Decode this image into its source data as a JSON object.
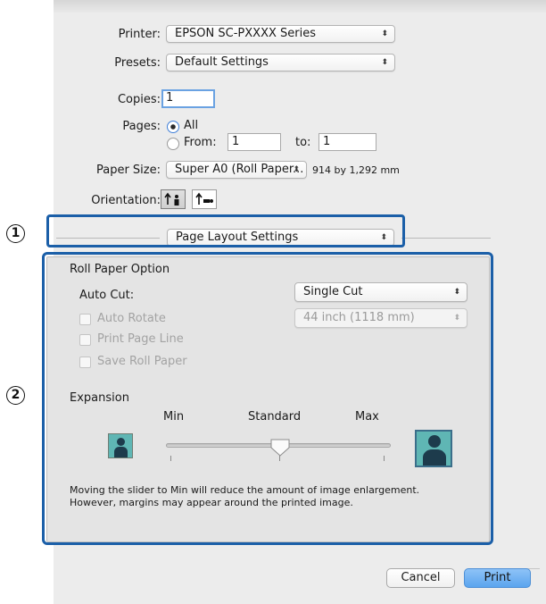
{
  "printer": {
    "label": "Printer:",
    "value": "EPSON SC-PXXXX Series"
  },
  "presets": {
    "label": "Presets:",
    "value": "Default Settings"
  },
  "copies": {
    "label": "Copies:",
    "value": "1"
  },
  "pages": {
    "label": "Pages:",
    "all_label": "All",
    "from_label": "From:",
    "from_value": "1",
    "to_label": "to:",
    "to_value": "1",
    "selected": "All"
  },
  "paper_size": {
    "label": "Paper Size:",
    "value": "Super A0 (Roll Paper...",
    "dimensions": "914 by 1,292 mm"
  },
  "orientation": {
    "label": "Orientation:",
    "selected": "portrait"
  },
  "section_popup": {
    "value": "Page Layout Settings"
  },
  "roll_paper": {
    "title": "Roll Paper Option",
    "auto_cut_label": "Auto Cut:",
    "auto_cut_value": "Single Cut",
    "auto_rotate_label": "Auto Rotate",
    "roll_width_value": "44 inch (1118 mm)",
    "print_page_line_label": "Print Page Line",
    "save_roll_paper_label": "Save Roll Paper"
  },
  "expansion": {
    "title": "Expansion",
    "min_label": "Min",
    "standard_label": "Standard",
    "max_label": "Max",
    "slider_position": "Standard",
    "note_line1": "Moving the slider to Min will reduce the amount of image enlargement.",
    "note_line2": "However, margins may appear around the printed image."
  },
  "callouts": {
    "one": "1",
    "two": "2"
  },
  "buttons": {
    "cancel": "Cancel",
    "print": "Print"
  },
  "colors": {
    "accent": "#5aa4ee",
    "callout": "#1b5fa8",
    "focus": "#6aa2e2"
  }
}
